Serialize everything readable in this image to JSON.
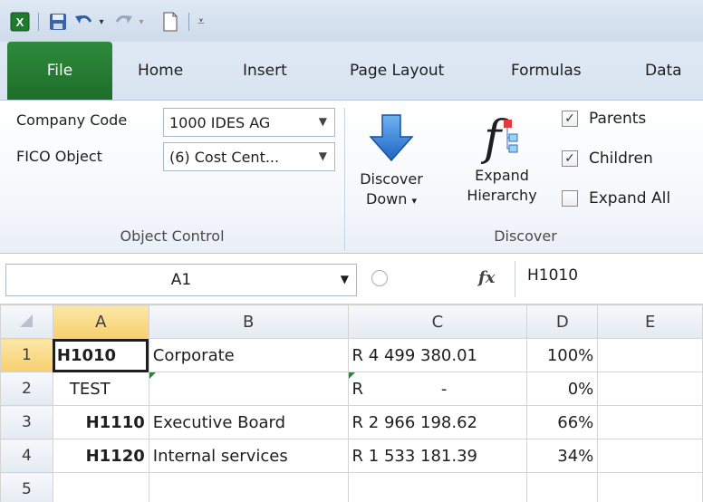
{
  "qat": {
    "icons": [
      "excel-icon",
      "save-icon",
      "undo-icon",
      "redo-icon",
      "new-doc-icon",
      "customize-icon"
    ]
  },
  "tabs": [
    {
      "label": "File"
    },
    {
      "label": "Home"
    },
    {
      "label": "Insert"
    },
    {
      "label": "Page Layout"
    },
    {
      "label": "Formulas"
    },
    {
      "label": "Data"
    }
  ],
  "ribbon": {
    "object_control": {
      "title": "Object Control",
      "company_code_label": "Company Code",
      "company_code_value": "1000 IDES AG",
      "fico_object_label": "FICO Object",
      "fico_object_value": "(6) Cost Cent..."
    },
    "discover": {
      "title": "Discover",
      "discover_down_line1": "Discover",
      "discover_down_line2": "Down",
      "expand_hierarchy_line1": "Expand",
      "expand_hierarchy_line2": "Hierarchy",
      "checks": [
        {
          "label": "Parents",
          "checked": true
        },
        {
          "label": "Children",
          "checked": true
        },
        {
          "label": "Expand All",
          "checked": false
        }
      ]
    }
  },
  "formula_bar": {
    "name_box": "A1",
    "fx_label": "fx",
    "value": "H1010"
  },
  "grid": {
    "columns": [
      "A",
      "B",
      "C",
      "D",
      "E"
    ],
    "rows": [
      {
        "num": "1",
        "a": "H1010",
        "b": "Corporate",
        "c": "R 4 499 380.01",
        "d": "100%",
        "e": ""
      },
      {
        "num": "2",
        "a": "TEST",
        "b": "",
        "c": "R               -",
        "d": "0%",
        "e": ""
      },
      {
        "num": "3",
        "a": "H1110",
        "b": "Executive Board",
        "c": "R 2 966 198.62",
        "d": "66%",
        "e": ""
      },
      {
        "num": "4",
        "a": "H1120",
        "b": "Internal services",
        "c": "R 1 533 181.39",
        "d": "34%",
        "e": ""
      },
      {
        "num": "5",
        "a": "",
        "b": "",
        "c": "",
        "d": "",
        "e": ""
      }
    ]
  },
  "colors": {
    "file_tab": "#1d6e29",
    "accent_blue": "#2c6fbf",
    "selection_header": "#f7cf6e"
  }
}
